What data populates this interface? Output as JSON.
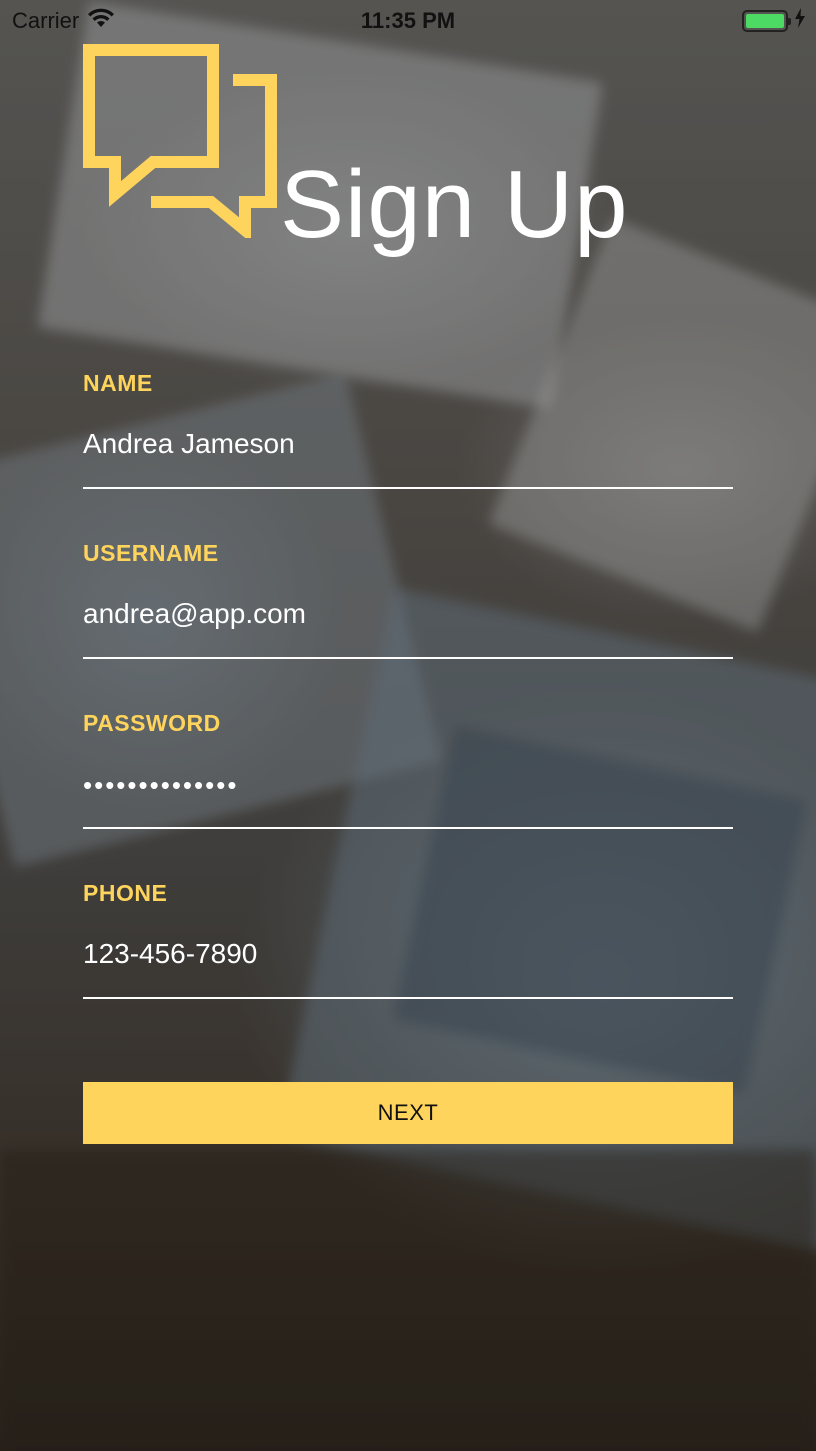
{
  "status_bar": {
    "carrier": "Carrier",
    "time": "11:35 PM",
    "icons": [
      "wifi-icon",
      "battery-icon",
      "charging-bolt-icon"
    ]
  },
  "header": {
    "logo_icon": "chat-bubbles-icon",
    "title": "Sign Up"
  },
  "form": {
    "fields": [
      {
        "label": "NAME",
        "value": "Andrea Jameson"
      },
      {
        "label": "USERNAME",
        "value": "andrea@app.com"
      },
      {
        "label": "PASSWORD",
        "value": "••••••••••••••"
      },
      {
        "label": "PHONE",
        "value": "123-456-7890"
      }
    ]
  },
  "actions": {
    "next_label": "NEXT"
  },
  "colors": {
    "accent": "#ffd45c",
    "text": "#ffffff",
    "battery": "#4cd964"
  }
}
